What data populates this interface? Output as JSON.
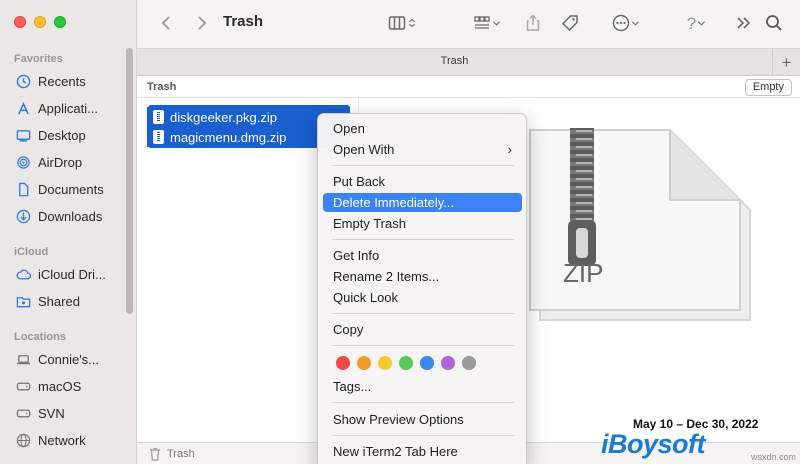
{
  "window": {
    "title": "Trash"
  },
  "sidebar": {
    "sections": [
      {
        "title": "Favorites",
        "items": [
          {
            "label": "Recents",
            "icon": "clock-icon"
          },
          {
            "label": "Applicati...",
            "icon": "applications-icon"
          },
          {
            "label": "Desktop",
            "icon": "desktop-icon"
          },
          {
            "label": "AirDrop",
            "icon": "airdrop-icon"
          },
          {
            "label": "Documents",
            "icon": "document-icon"
          },
          {
            "label": "Downloads",
            "icon": "download-icon"
          }
        ]
      },
      {
        "title": "iCloud",
        "items": [
          {
            "label": "iCloud Dri...",
            "icon": "cloud-icon"
          },
          {
            "label": "Shared",
            "icon": "shared-folder-icon"
          }
        ]
      },
      {
        "title": "Locations",
        "items": [
          {
            "label": "Connie's...",
            "icon": "laptop-icon"
          },
          {
            "label": "macOS",
            "icon": "disk-icon"
          },
          {
            "label": "SVN",
            "icon": "disk-icon"
          },
          {
            "label": "Network",
            "icon": "network-icon"
          }
        ]
      }
    ]
  },
  "tabbar": {
    "tab_label": "Trash",
    "add_label": "+"
  },
  "pathbar": {
    "label": "Trash",
    "empty_button": "Empty"
  },
  "files": [
    {
      "name": "diskgeeker.pkg.zip",
      "selected": true
    },
    {
      "name": "magicmenu.dmg.zip",
      "selected": true
    }
  ],
  "preview": {
    "type_label": "ZIP"
  },
  "statusbar": {
    "label": "Trash"
  },
  "context_menu": {
    "items": [
      {
        "label": "Open"
      },
      {
        "label": "Open With",
        "submenu": true
      },
      {
        "label": "Put Back"
      },
      {
        "label": "Delete Immediately...",
        "highlighted": true
      },
      {
        "label": "Empty Trash"
      },
      {
        "label": "Get Info"
      },
      {
        "label": "Rename 2 Items..."
      },
      {
        "label": "Quick Look"
      },
      {
        "label": "Copy"
      },
      {
        "label": "Tags..."
      },
      {
        "label": "Show Preview Options"
      },
      {
        "label": "New iTerm2 Tab Here"
      }
    ],
    "submenu_arrow": "›",
    "tag_colors": [
      "#f04a48",
      "#f39a2c",
      "#f4cc30",
      "#5ac75a",
      "#3b87f0",
      "#b164d8",
      "#9a9a9a"
    ]
  },
  "watermark": {
    "date_range": "May 10 – Dec 30, 2022",
    "logo": "iBoysoft",
    "site": "wsxdn.com"
  },
  "colors": {
    "selection": "#1a5fd0",
    "highlight": "#3b82f5",
    "accent": "#1b7bd3"
  }
}
